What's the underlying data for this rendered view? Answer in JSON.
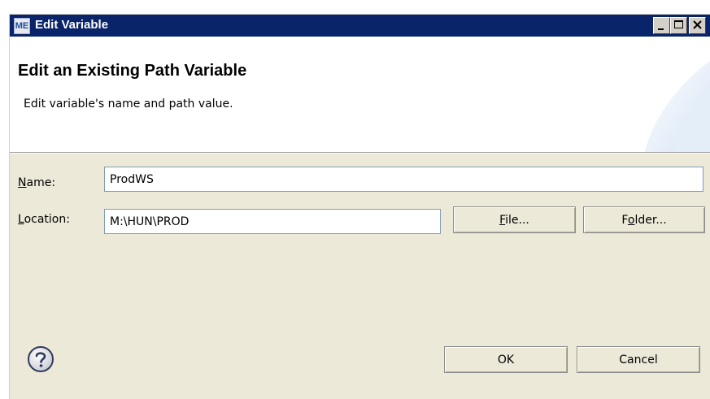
{
  "window": {
    "title": "Edit Variable",
    "app_icon_text": "ME",
    "controls": [
      "minimize-icon",
      "maximize-icon",
      "close-icon"
    ]
  },
  "banner": {
    "heading": "Edit an Existing Path Variable",
    "description": "Edit variable's name and path value."
  },
  "form": {
    "name_label_mnemonic": "N",
    "name_label_rest": "ame:",
    "name_value": "ProdWS",
    "location_label_mnemonic": "L",
    "location_label_rest": "ocation:",
    "location_value": "M:\\HUN\\PROD"
  },
  "buttons": {
    "file_mnemonic": "F",
    "file_rest": "ile...",
    "folder_prefix": "F",
    "folder_mnemonic": "o",
    "folder_rest": "lder...",
    "ok_label": "OK",
    "cancel_label": "Cancel"
  },
  "icons": {
    "help": "help-icon"
  },
  "colors": {
    "titlebar": "#0a246a",
    "dialog_bg": "#ece9d8",
    "banner_bg": "#ffffff",
    "banner_accent": "#dde9f7"
  }
}
